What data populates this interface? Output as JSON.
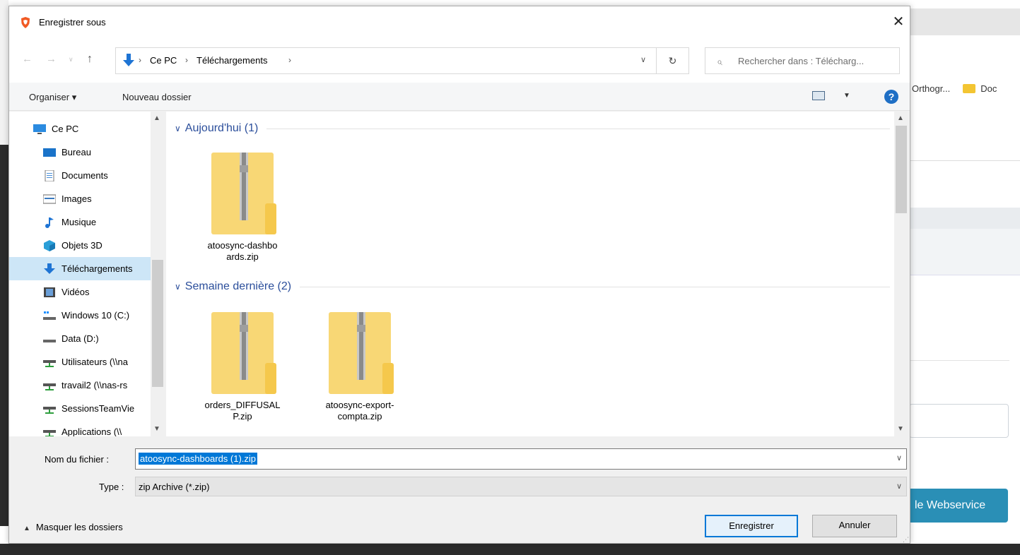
{
  "background": {
    "bookmarks": [
      {
        "label": "Orthogr..."
      },
      {
        "label": "Doc"
      }
    ],
    "button_label": "le Webservice"
  },
  "dialog": {
    "title": "Enregistrer sous",
    "close_icon": "close-icon",
    "nav": {
      "back_icon": "arrow-left-icon",
      "forward_icon": "arrow-right-icon",
      "recent_icon": "chevron-down-icon",
      "up_icon": "arrow-up-icon"
    },
    "address": {
      "crumbs": [
        "Ce PC",
        "Téléchargements"
      ],
      "separator": "›"
    },
    "search": {
      "placeholder": "Rechercher dans : Télécharg..."
    },
    "toolbar": {
      "organize_label": "Organiser ▾",
      "new_folder_label": "Nouveau dossier",
      "help_label": "?"
    },
    "navpane": {
      "items": [
        {
          "label": "Ce PC",
          "icon": "computer-icon",
          "selected": false
        },
        {
          "label": "Bureau",
          "icon": "desktop-icon",
          "selected": false
        },
        {
          "label": "Documents",
          "icon": "documents-icon",
          "selected": false
        },
        {
          "label": "Images",
          "icon": "images-icon",
          "selected": false
        },
        {
          "label": "Musique",
          "icon": "music-icon",
          "selected": false
        },
        {
          "label": "Objets 3D",
          "icon": "objects-3d-icon",
          "selected": false
        },
        {
          "label": "Téléchargements",
          "icon": "downloads-icon",
          "selected": true
        },
        {
          "label": "Vidéos",
          "icon": "videos-icon",
          "selected": false
        },
        {
          "label": "Windows 10 (C:)",
          "icon": "drive-windows-icon",
          "selected": false
        },
        {
          "label": "Data (D:)",
          "icon": "drive-icon",
          "selected": false
        },
        {
          "label": "Utilisateurs (\\\\na",
          "icon": "network-drive-icon",
          "selected": false
        },
        {
          "label": "travail2 (\\\\nas-rs",
          "icon": "network-drive-icon",
          "selected": false
        },
        {
          "label": "SessionsTeamVie",
          "icon": "network-drive-icon",
          "selected": false
        },
        {
          "label": "Applications (\\\\",
          "icon": "network-drive-icon",
          "selected": false
        }
      ]
    },
    "groups": [
      {
        "label": "Aujourd'hui (1)",
        "files": [
          {
            "name_line1": "atoosync-dashbo",
            "name_line2": "ards.zip"
          }
        ]
      },
      {
        "label": "Semaine dernière (2)",
        "files": [
          {
            "name_line1": "orders_DIFFUSAL",
            "name_line2": "P.zip"
          },
          {
            "name_line1": "atoosync-export-",
            "name_line2": "compta.zip"
          }
        ]
      }
    ],
    "filename": {
      "label": "Nom du fichier :",
      "value": "atoosync-dashboards (1).zip"
    },
    "filetype": {
      "label": "Type :",
      "value": "zip Archive (*.zip)"
    },
    "hide_folders_label": "Masquer les dossiers",
    "save_label": "Enregistrer",
    "cancel_label": "Annuler",
    "colors": {
      "accent": "#0078d7",
      "group_header": "#2b4e9b",
      "folder_yellow": "#f8d775",
      "selection": "#cde6f7"
    }
  }
}
